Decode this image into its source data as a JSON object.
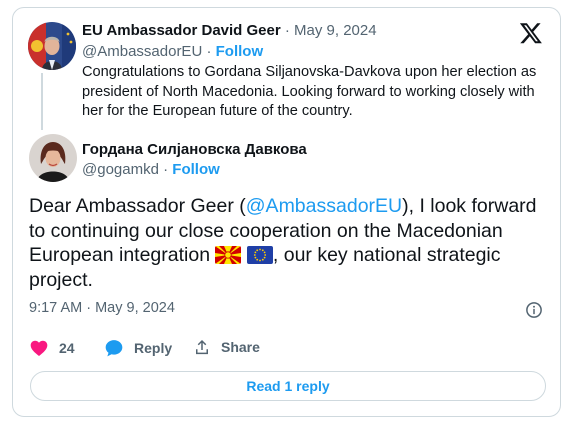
{
  "quoted": {
    "author_name": "EU Ambassador David Geer",
    "separator": "·",
    "date": "May 9, 2024",
    "handle": "@AmbassadorEU",
    "follow_label": "Follow",
    "text": "Congratulations to Gordana Siljanovska-Davkova upon her election as president of North Macedonia. Looking forward to working closely with her for the European future of the country."
  },
  "main": {
    "author_name": "Гордана Силјановска Давкова",
    "handle": "@gogamkd",
    "separator": "·",
    "follow_label": "Follow",
    "text_before": "Dear Ambassador Geer (",
    "mention": "@AmbassadorEU",
    "text_middle": "), I look forward to continuing our close cooperation on the Macedonian European integration ",
    "text_after": ", our key national strategic project.",
    "flags": [
      "flag-north-macedonia",
      "flag-european-union"
    ],
    "timestamp": "9:17 AM · May 9, 2024"
  },
  "actions": {
    "like_count": "24",
    "reply_label": "Reply",
    "share_label": "Share"
  },
  "read_replies_label": "Read 1 reply",
  "colors": {
    "accent": "#1d9bf0",
    "like": "#f91880",
    "text": "#0f1419",
    "muted": "#536471",
    "border": "#cfd9de"
  },
  "icons": [
    "x-logo-icon",
    "info-icon",
    "heart-icon",
    "reply-bubble-icon",
    "share-icon"
  ]
}
